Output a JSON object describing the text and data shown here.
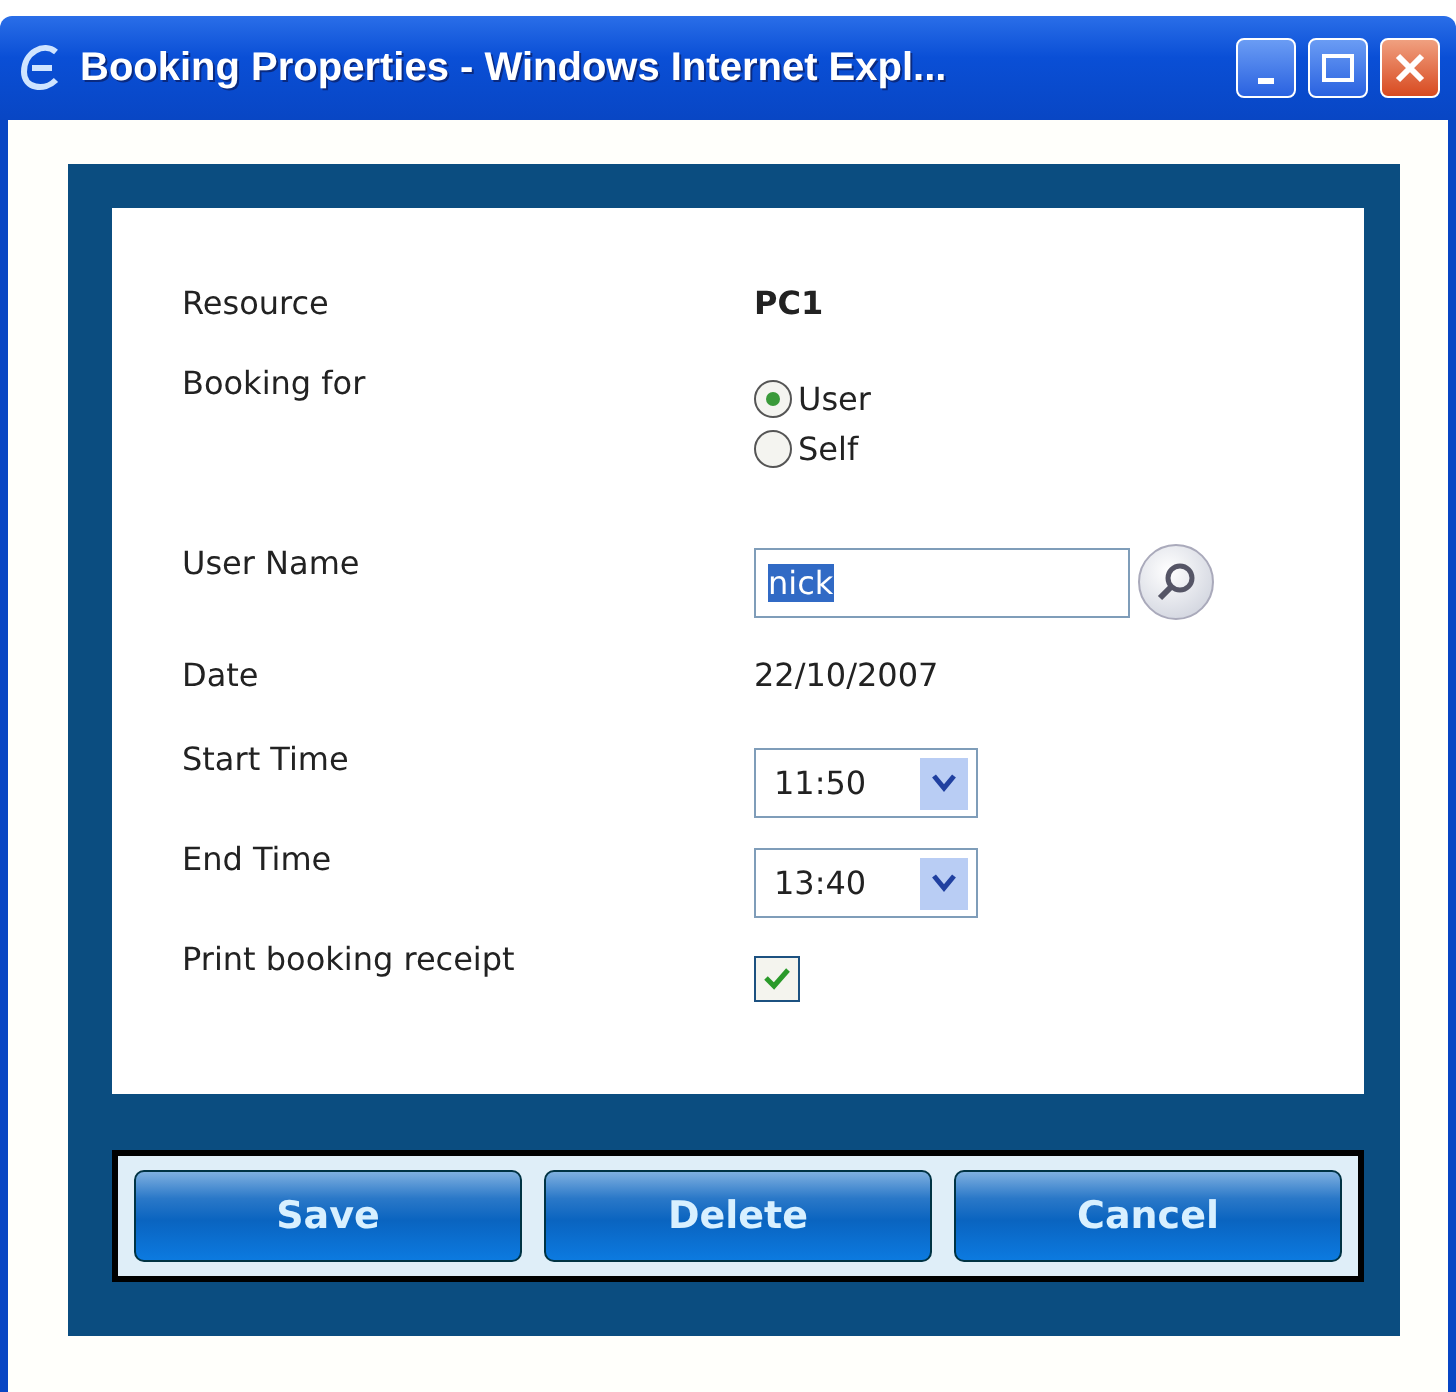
{
  "window": {
    "title": "Booking Properties - Windows Internet Expl..."
  },
  "fields": [
    {
      "kind": "text",
      "label": "Resource",
      "value": "PC1"
    },
    {
      "kind": "radio",
      "label": "Booking for",
      "options": [
        {
          "label": "User",
          "selected": true
        },
        {
          "label": "Self",
          "selected": false
        }
      ]
    },
    {
      "kind": "input",
      "label": "User Name",
      "value": "nick"
    },
    {
      "kind": "plain",
      "label": "Date",
      "value": "22/10/2007"
    },
    {
      "kind": "select",
      "label": "Start Time",
      "value": "11:50"
    },
    {
      "kind": "select",
      "label": "End Time",
      "value": "13:40"
    },
    {
      "kind": "checkbox",
      "label": "Print booking receipt",
      "checked": true
    }
  ],
  "buttons": [
    "Save",
    "Delete",
    "Cancel"
  ]
}
